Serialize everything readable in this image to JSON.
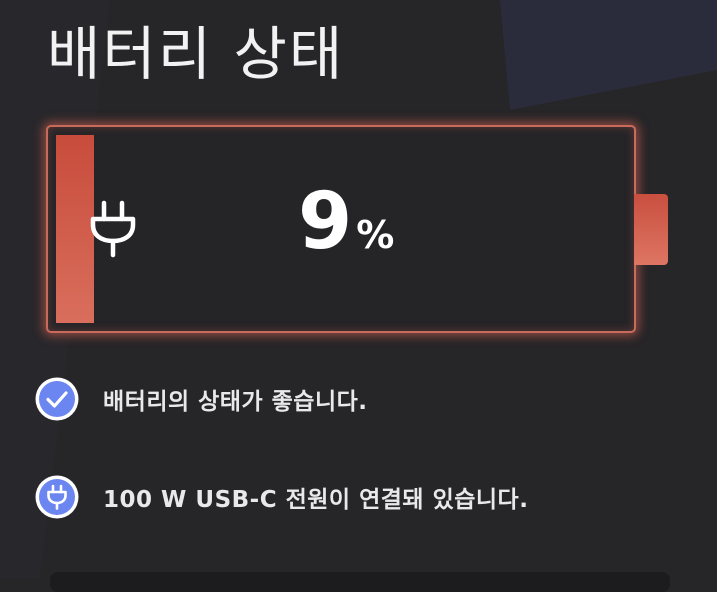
{
  "header": {
    "title": "배터리 상태"
  },
  "battery": {
    "percent_value": "9",
    "percent_sign": "%",
    "level_fraction": 0.09,
    "charging": true,
    "accent_color": "#d8604c",
    "icon": "plug-icon"
  },
  "status": [
    {
      "icon": "checkmark-icon",
      "text": "배터리의 상태가 좋습니다."
    },
    {
      "icon": "plug-icon",
      "text": "100 W USB-C 전원이 연결돼 있습니다."
    }
  ],
  "colors": {
    "background": "#262528",
    "status_icon": "#6b86f0",
    "battery_glow": "#e26854"
  }
}
